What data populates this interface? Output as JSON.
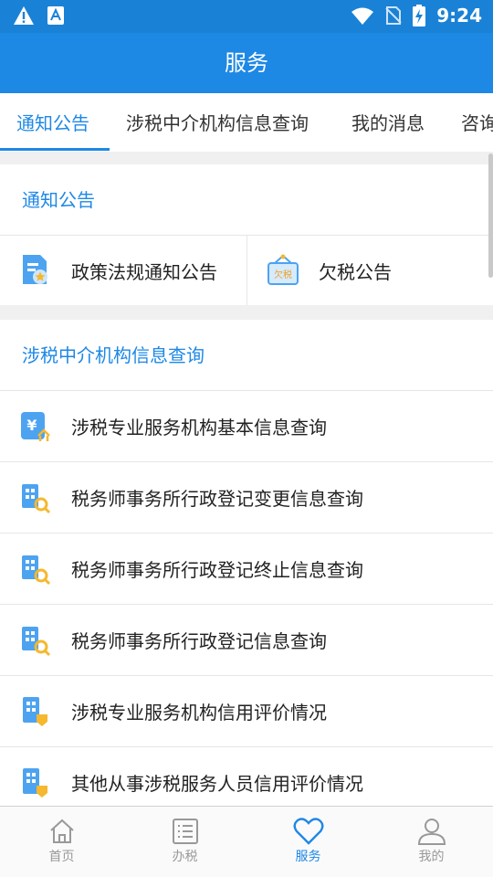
{
  "status_bar": {
    "time": "9:24",
    "icons": [
      "warning-icon",
      "a-box-icon",
      "wifi-icon",
      "no-sim-icon",
      "battery-charging-icon"
    ]
  },
  "app_bar": {
    "title": "服务"
  },
  "tabs": [
    {
      "label": "通知公告",
      "active": true
    },
    {
      "label": "涉税中介机构信息查询",
      "active": false
    },
    {
      "label": "我的消息",
      "active": false
    },
    {
      "label": "咨询",
      "active": false
    }
  ],
  "sections": {
    "notices": {
      "title": "通知公告",
      "items": [
        {
          "label": "政策法规通知公告",
          "icon": "policy-document-icon"
        },
        {
          "label": "欠税公告",
          "icon": "tax-arrears-sign-icon",
          "icon_text": "欠税"
        }
      ]
    },
    "agencies": {
      "title": "涉税中介机构信息查询",
      "items": [
        {
          "label": "涉税专业服务机构基本信息查询",
          "icon": "yuan-agency-icon",
          "icon_text": "¥"
        },
        {
          "label": "税务师事务所行政登记变更信息查询",
          "icon": "building-search-icon"
        },
        {
          "label": "税务师事务所行政登记终止信息查询",
          "icon": "building-search-icon"
        },
        {
          "label": "税务师事务所行政登记信息查询",
          "icon": "building-search-icon"
        },
        {
          "label": "涉税专业服务机构信用评价情况",
          "icon": "building-badge-icon"
        },
        {
          "label": "其他从事涉税服务人员信用评价情况",
          "icon": "building-badge-icon"
        }
      ]
    }
  },
  "bottom_nav": [
    {
      "label": "首页",
      "icon": "home-icon"
    },
    {
      "label": "办税",
      "icon": "list-icon"
    },
    {
      "label": "服务",
      "icon": "heart-icon",
      "active": true
    },
    {
      "label": "我的",
      "icon": "user-icon"
    }
  ],
  "colors": {
    "primary": "#1e88e5",
    "status_bar": "#1a82d6",
    "text": "#222222",
    "inactive": "#999999"
  }
}
